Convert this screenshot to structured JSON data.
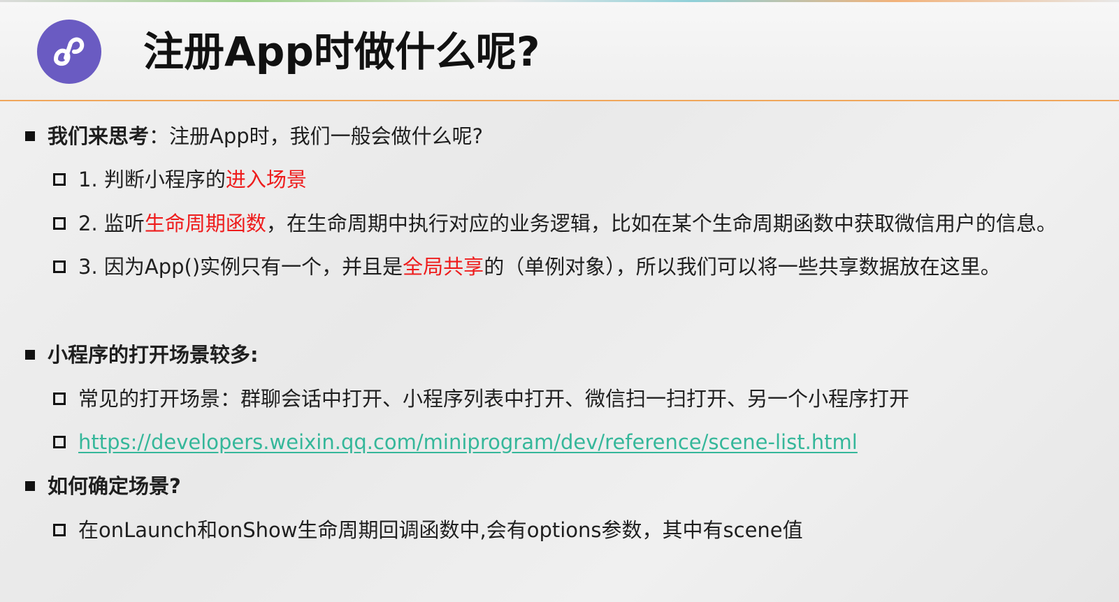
{
  "slide": {
    "title": "注册App时做什么呢?",
    "logo_icon": "miniprogram-logo-icon",
    "colors": {
      "logo": "#6a5bc2",
      "accent_rule": "#f0a65a",
      "highlight": "#ee1c1c",
      "link": "#35b79a"
    }
  },
  "sections": {
    "think": {
      "heading": "我们来思考",
      "text": "：注册App时，我们一般会做什么呢?",
      "items": [
        {
          "prefix": "1. 判断小程序的",
          "highlight": "进入场景",
          "suffix": ""
        },
        {
          "prefix": "2. 监听",
          "highlight": "生命周期函数",
          "suffix": "，在生命周期中执行对应的业务逻辑，比如在某个生命周期函数中获取微信用户的信息。"
        },
        {
          "prefix": "3. 因为App()实例只有一个，并且是",
          "highlight": "全局共享",
          "suffix": "的（单例对象），所以我们可以将一些共享数据放在这里。"
        }
      ]
    },
    "scenes": {
      "heading": "小程序的打开场景较多:",
      "items": [
        {
          "text": "常见的打开场景：群聊会话中打开、小程序列表中打开、微信扫一扫打开、另一个小程序打开"
        },
        {
          "link": "https://developers.weixin.qq.com/miniprogram/dev/reference/scene-list.html"
        }
      ]
    },
    "determine": {
      "heading": "如何确定场景?",
      "items": [
        {
          "text": "在onLaunch和onShow生命周期回调函数中,会有options参数，其中有scene值"
        }
      ]
    }
  }
}
